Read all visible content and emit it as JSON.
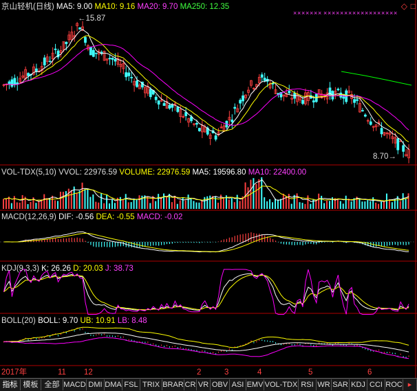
{
  "header": {
    "title": "京山轻机(日线)",
    "ma5": "MA5: 9.00",
    "ma10": "MA10: 9.16",
    "ma20": "MA20: 9.70",
    "ma250": "MA250: 12.35"
  },
  "vol_header": {
    "title": "VOL-TDX(5,10)",
    "vvol": "VVOL: 22976.59",
    "volume": "VOLUME: 22976.59",
    "ma5": "MA5: 19596.80",
    "ma10": "MA10: 22400.00"
  },
  "macd_header": {
    "title": "MACD(12,26,9)",
    "dif": "DIF: -0.56",
    "dea": "DEA: -0.55",
    "macd": "MACD: -0.02"
  },
  "kdj_header": {
    "title": "KDJ(9,3,3)",
    "k": "K: 26.26",
    "d": "D: 20.03",
    "j": "J: 38.73"
  },
  "boll_header": {
    "title": "BOLL(20)",
    "boll": "BOLL: 9.70",
    "ub": "UB: 10.91",
    "lb": "LB: 8.48"
  },
  "annotations": {
    "high": "15.87",
    "low": "8.70"
  },
  "x_axis": [
    "2017年",
    "11",
    "12",
    "2",
    "3",
    "4",
    "5",
    "6"
  ],
  "tabs": [
    "指标",
    "模板",
    "全部",
    "MACD",
    "DMI",
    "DMA",
    "FSL",
    "TRIX",
    "BRAR",
    "CR",
    "VR",
    "OBV",
    "ASI",
    "EMV",
    "VOL-TDX",
    "RSI",
    "WR",
    "SAR",
    "KDJ",
    "CCI",
    "ROC"
  ],
  "colors": {
    "up": "#ff4040",
    "down": "#40ffff",
    "ma5": "#ffffff",
    "ma10": "#ffff00",
    "ma20": "#ff00ff",
    "ma250": "#00ff00",
    "background": "#000000"
  },
  "chart_data": {
    "type": "candlestick",
    "title": "京山轻机(日线)",
    "price_range": [
      8.7,
      15.87
    ],
    "series": [
      {
        "name": "MA5",
        "last": 9.0
      },
      {
        "name": "MA10",
        "last": 9.16
      },
      {
        "name": "MA20",
        "last": 9.7
      },
      {
        "name": "MA250",
        "last": 12.35
      }
    ],
    "annotations": [
      {
        "label": "15.87",
        "kind": "high"
      },
      {
        "label": "8.70",
        "kind": "low"
      }
    ],
    "indicators": {
      "VOL-TDX": {
        "VVOL": 22976.59,
        "VOLUME": 22976.59,
        "MA5": 19596.8,
        "MA10": 22400.0
      },
      "MACD": {
        "DIF": -0.56,
        "DEA": -0.55,
        "MACD": -0.02
      },
      "KDJ": {
        "K": 26.26,
        "D": 20.03,
        "J": 38.73
      },
      "BOLL": {
        "BOLL": 9.7,
        "UB": 10.91,
        "LB": 8.48
      }
    },
    "x_ticks": [
      "2017年",
      "11",
      "12",
      "2",
      "3",
      "4",
      "5",
      "6"
    ]
  }
}
